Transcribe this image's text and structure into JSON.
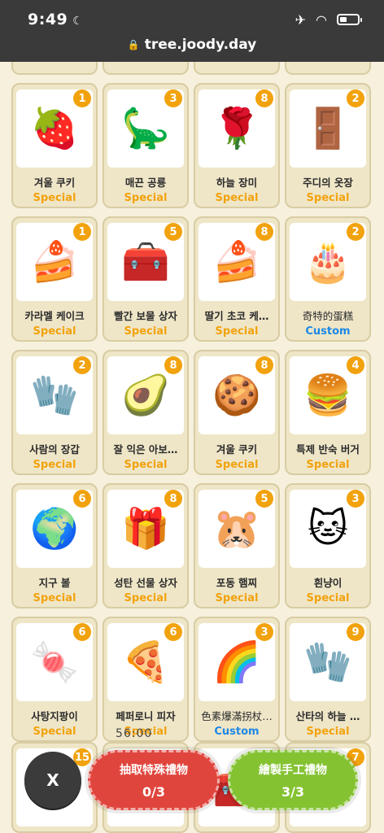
{
  "status_bar": {
    "time": "9:49",
    "moon_icon": "moon-icon",
    "airplane_icon": "airplane-icon",
    "wifi_icon": "wifi-icon",
    "battery_icon": "battery-icon"
  },
  "browser": {
    "url": "tree.joody.day",
    "lock_icon": "lock-icon"
  },
  "items": [
    {
      "name": "겨울 쿠키",
      "tag": "Special",
      "count": "1",
      "emoji": "🍓"
    },
    {
      "name": "매끈 공룡",
      "tag": "Special",
      "count": "3",
      "emoji": "🦕"
    },
    {
      "name": "하늘 장미",
      "tag": "Special",
      "count": "8",
      "emoji": "🌹"
    },
    {
      "name": "주디의 옷장",
      "tag": "Special",
      "count": "2",
      "emoji": "🚪"
    },
    {
      "name": "카라멜 케이크",
      "tag": "Special",
      "count": "1",
      "emoji": "🍰"
    },
    {
      "name": "빨간 보물 상자",
      "tag": "Special",
      "count": "5",
      "emoji": "🧰"
    },
    {
      "name": "딸기 초코 케…",
      "tag": "Special",
      "count": "8",
      "emoji": "🍰"
    },
    {
      "name": "奇特的蛋糕",
      "tag": "Custom",
      "count": "2",
      "emoji": "🎂"
    },
    {
      "name": "사람의 장갑",
      "tag": "Special",
      "count": "2",
      "emoji": "🧤"
    },
    {
      "name": "잘 익은 아보…",
      "tag": "Special",
      "count": "8",
      "emoji": "🥑"
    },
    {
      "name": "겨울 쿠키",
      "tag": "Special",
      "count": "8",
      "emoji": "🍪"
    },
    {
      "name": "특제 반숙 버거",
      "tag": "Special",
      "count": "4",
      "emoji": "🍔"
    },
    {
      "name": "지구 볼",
      "tag": "Special",
      "count": "6",
      "emoji": "🌍"
    },
    {
      "name": "성탄 선물 상자",
      "tag": "Special",
      "count": "8",
      "emoji": "🎁"
    },
    {
      "name": "포동 햄찌",
      "tag": "Special",
      "count": "5",
      "emoji": "🐹"
    },
    {
      "name": "흰냥이",
      "tag": "Special",
      "count": "3",
      "emoji": "🐱"
    },
    {
      "name": "사탕지팡이",
      "tag": "Special",
      "count": "6",
      "emoji": "🍬"
    },
    {
      "name": "페퍼로니 피자",
      "tag": "Special",
      "count": "6",
      "emoji": "🍕"
    },
    {
      "name": "色素爆滿拐杖…",
      "tag": "Custom",
      "count": "3",
      "emoji": "🌈"
    },
    {
      "name": "산타의 하늘 …",
      "tag": "Special",
      "count": "9",
      "emoji": "🧤"
    }
  ],
  "bottom_items": [
    {
      "count": "15",
      "emoji": "🎀"
    },
    {
      "count": "",
      "emoji": "🍫"
    },
    {
      "count": "",
      "emoji": "🧰"
    },
    {
      "count": "7",
      "emoji": "🍰"
    }
  ],
  "timer": "56:00",
  "actions": {
    "close_label": "X",
    "draw_label": "抽取特殊禮物",
    "draw_count": "0/3",
    "craft_label": "繪製手工禮物",
    "craft_count": "3/3"
  },
  "colors": {
    "special": "#f2a20c",
    "custom": "#1e88e5",
    "red_button": "#e0453d",
    "green_button": "#84c232"
  }
}
